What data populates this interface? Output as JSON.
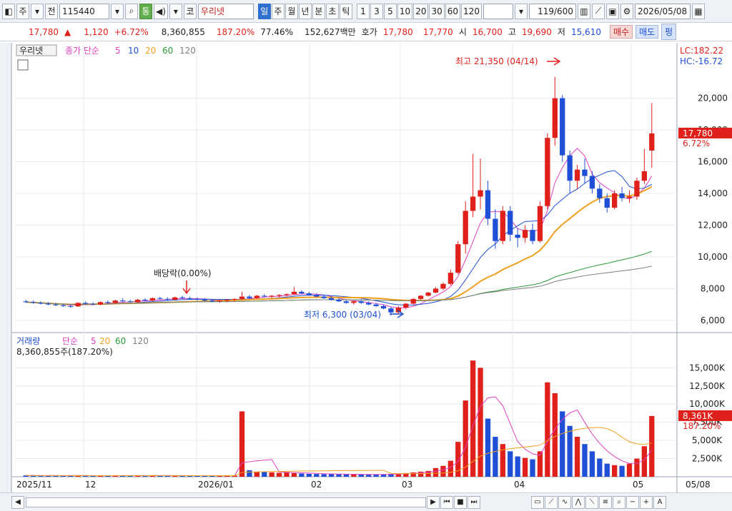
{
  "toolbar": {
    "market_btn": "주",
    "prev_btn": "전",
    "code": "115440",
    "tong_btn": "통",
    "co_btn": "코",
    "name": "우리넷",
    "periods": [
      "일",
      "주",
      "월",
      "년",
      "분",
      "초",
      "틱"
    ],
    "selected_period": "일",
    "intervals": [
      "1",
      "3",
      "5",
      "10",
      "20",
      "30",
      "60",
      "120"
    ],
    "count": "119/600",
    "date": "2026/05/08",
    "extra": "펑"
  },
  "quote": {
    "price": "17,780",
    "arrow": "▲",
    "change": "1,120",
    "rate": "+6.72%",
    "volume": "8,360,855",
    "vol_ratio": "187.20%",
    "turnover": "77.46%",
    "amount": "152,627백만",
    "hoga_label": "호가",
    "ask": "17,780",
    "bid": "17,770",
    "open_label": "시",
    "open": "16,700",
    "high_label": "고",
    "high": "19,690",
    "low_label": "저",
    "low": "15,610",
    "buy_btn": "매수",
    "sell_btn": "매도"
  },
  "price_panel": {
    "legend_name": "우리넷",
    "legend_close": "종가 단순",
    "ma": [
      "5",
      "10",
      "20",
      "60",
      "120"
    ],
    "lc": "LC:182.22",
    "hc": "HC:-16.72",
    "current_price": "17,780",
    "current_rate": "6.72%",
    "high_note": "최고 21,350 (04/14)",
    "low_note": "최저 6,300 (03/04)",
    "dividend_note": "배당락(0.00%)",
    "y_ticks": [
      "20,000",
      "18,000",
      "16,000",
      "14,000",
      "12,000",
      "10,000",
      "8,000",
      "6,000"
    ]
  },
  "volume_panel": {
    "legend_name": "거래량",
    "legend_ma": "단순",
    "ma": [
      "5",
      "20",
      "60",
      "120"
    ],
    "summary": "8,360,855주(187.20%)",
    "current": "8,361K",
    "current_rate": "187.20%",
    "y_ticks": [
      "15,000K",
      "12,500K",
      "10,000K",
      "7,500K",
      "5,000K",
      "2,500K"
    ]
  },
  "x_axis": [
    "2025/11",
    "12",
    "2026/01",
    "02",
    "03",
    "04",
    "05",
    "05/08"
  ],
  "colors": {
    "up": "#e0201b",
    "down": "#1f4fd6",
    "ma5": "#e040c0",
    "ma10": "#1f4fd6",
    "ma20": "#f0a020",
    "ma60": "#2a9a3a",
    "ma120": "#808080"
  },
  "chart_data": {
    "type": "candlestick",
    "y_range": [
      5500,
      22500
    ],
    "candles": [
      [
        7200,
        7300,
        7100,
        7150
      ],
      [
        7150,
        7250,
        7050,
        7100
      ],
      [
        7100,
        7200,
        7000,
        7050
      ],
      [
        7050,
        7150,
        6950,
        7000
      ],
      [
        7000,
        7100,
        6900,
        6950
      ],
      [
        6950,
        7050,
        6850,
        6900
      ],
      [
        6900,
        7000,
        6800,
        6880
      ],
      [
        6880,
        7150,
        6850,
        7100
      ],
      [
        7100,
        7200,
        7000,
        7050
      ],
      [
        7050,
        7150,
        6950,
        7000
      ],
      [
        7000,
        7200,
        6950,
        7150
      ],
      [
        7150,
        7250,
        7050,
        7100
      ],
      [
        7100,
        7300,
        7050,
        7250
      ],
      [
        7250,
        7400,
        7150,
        7200
      ],
      [
        7200,
        7300,
        7100,
        7150
      ],
      [
        7150,
        7350,
        7100,
        7300
      ],
      [
        7300,
        7400,
        7200,
        7250
      ],
      [
        7250,
        7450,
        7200,
        7400
      ],
      [
        7400,
        7500,
        7300,
        7350
      ],
      [
        7350,
        7450,
        7250,
        7300
      ],
      [
        7300,
        7500,
        7250,
        7450
      ],
      [
        7450,
        7550,
        7350,
        7400
      ],
      [
        7400,
        7500,
        7300,
        7350
      ],
      [
        7350,
        7450,
        7250,
        7300
      ],
      [
        7300,
        7400,
        7200,
        7250
      ],
      [
        7250,
        7350,
        7150,
        7200
      ],
      [
        7200,
        7300,
        7100,
        7250
      ],
      [
        7250,
        7350,
        7150,
        7300
      ],
      [
        7300,
        7400,
        7200,
        7350
      ],
      [
        7350,
        7800,
        7300,
        7500
      ],
      [
        7500,
        7600,
        7350,
        7400
      ],
      [
        7400,
        7600,
        7350,
        7550
      ],
      [
        7550,
        7650,
        7450,
        7500
      ],
      [
        7500,
        7600,
        7400,
        7550
      ],
      [
        7550,
        7650,
        7450,
        7600
      ],
      [
        7600,
        7700,
        7500,
        7650
      ],
      [
        7650,
        8100,
        7600,
        7800
      ],
      [
        7800,
        7900,
        7650,
        7700
      ],
      [
        7700,
        7800,
        7550,
        7600
      ],
      [
        7600,
        7700,
        7450,
        7500
      ],
      [
        7500,
        7600,
        7350,
        7400
      ],
      [
        7400,
        7500,
        7250,
        7300
      ],
      [
        7300,
        7400,
        7150,
        7200
      ],
      [
        7200,
        7300,
        7050,
        7100
      ],
      [
        7100,
        7250,
        7000,
        7200
      ],
      [
        7200,
        7300,
        7050,
        7100
      ],
      [
        7100,
        7200,
        6950,
        7000
      ],
      [
        7000,
        7100,
        6850,
        6900
      ],
      [
        6900,
        7000,
        6700,
        6750
      ],
      [
        6750,
        6850,
        6300,
        6500
      ],
      [
        6500,
        6900,
        6400,
        6800
      ],
      [
        6800,
        7100,
        6700,
        7050
      ],
      [
        7050,
        7400,
        7000,
        7350
      ],
      [
        7350,
        7600,
        7300,
        7550
      ],
      [
        7550,
        7800,
        7500,
        7750
      ],
      [
        7750,
        8100,
        7700,
        8000
      ],
      [
        8000,
        8400,
        7900,
        8300
      ],
      [
        8300,
        9200,
        8200,
        9000
      ],
      [
        9000,
        11000,
        8900,
        10800
      ],
      [
        10800,
        13500,
        10200,
        12900
      ],
      [
        12900,
        16500,
        12500,
        13800
      ],
      [
        13800,
        16200,
        13000,
        14200
      ],
      [
        14200,
        14800,
        12000,
        12400
      ],
      [
        12400,
        13000,
        10500,
        11000
      ],
      [
        11000,
        13200,
        10800,
        12900
      ],
      [
        12900,
        13200,
        11000,
        11400
      ],
      [
        11400,
        11800,
        10600,
        11200
      ],
      [
        11200,
        12000,
        10900,
        11700
      ],
      [
        11700,
        12100,
        10800,
        11000
      ],
      [
        11000,
        13500,
        10900,
        13200
      ],
      [
        13200,
        17800,
        13000,
        17500
      ],
      [
        17500,
        21350,
        17000,
        20000
      ],
      [
        20000,
        20200,
        16000,
        16400
      ],
      [
        16400,
        16700,
        14000,
        14800
      ],
      [
        14800,
        15800,
        14300,
        15500
      ],
      [
        15500,
        16200,
        14600,
        15100
      ],
      [
        15100,
        15400,
        14000,
        14300
      ],
      [
        14300,
        14600,
        13400,
        13700
      ],
      [
        13700,
        14000,
        12800,
        13100
      ],
      [
        13100,
        14200,
        13000,
        14000
      ],
      [
        14000,
        14400,
        13500,
        13700
      ],
      [
        13700,
        14200,
        13400,
        13800
      ],
      [
        13800,
        15000,
        13600,
        14800
      ],
      [
        14800,
        16800,
        14600,
        15400
      ],
      [
        16700,
        19690,
        15610,
        17780
      ]
    ],
    "volumes": [
      180,
      160,
      150,
      140,
      150,
      160,
      170,
      150,
      140,
      130,
      150,
      160,
      170,
      150,
      140,
      160,
      150,
      170,
      160,
      150,
      160,
      150,
      140,
      150,
      160,
      150,
      140,
      150,
      160,
      9000,
      900,
      700,
      650,
      600,
      550,
      600,
      500,
      450,
      400,
      380,
      360,
      350,
      340,
      330,
      320,
      310,
      300,
      320,
      340,
      400,
      450,
      500,
      600,
      700,
      800,
      1200,
      1500,
      2200,
      4800,
      10500,
      16000,
      15000,
      8000,
      5500,
      4500,
      3500,
      2800,
      2600,
      2400,
      3500,
      13000,
      11500,
      9000,
      7000,
      5500,
      4500,
      3500,
      2500,
      1800,
      1600,
      1500,
      1800,
      2500,
      4200,
      8361
    ]
  }
}
